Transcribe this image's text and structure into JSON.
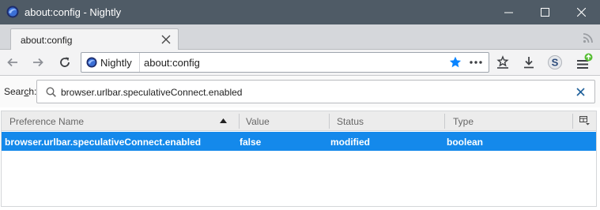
{
  "window": {
    "title": "about:config - Nightly"
  },
  "tabs": [
    {
      "label": "about:config"
    }
  ],
  "navbar": {
    "brand": "Nightly",
    "url": "about:config",
    "accent_color": "#0a84ff"
  },
  "search": {
    "label_prefix": "Sear",
    "label_accesskey": "c",
    "label_suffix": "h:",
    "value": "browser.urlbar.speculativeConnect.enabled"
  },
  "table": {
    "columns": [
      {
        "label": "Preference Name"
      },
      {
        "label": "Value"
      },
      {
        "label": "Status"
      },
      {
        "label": "Type"
      }
    ],
    "rows": [
      {
        "name": "browser.urlbar.speculativeConnect.enabled",
        "value": "false",
        "status": "modified",
        "type": "boolean"
      }
    ],
    "selected_row_color": "#1489eb"
  }
}
